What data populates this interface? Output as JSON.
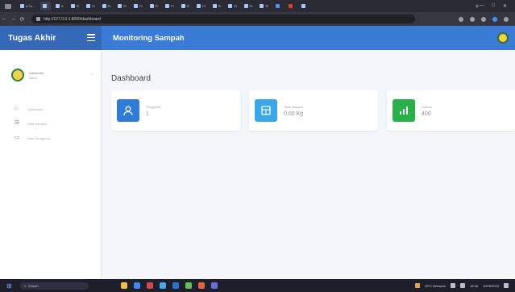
{
  "browser": {
    "tabs": [
      {
        "title": "A Tu…",
        "active": false
      },
      {
        "title": "",
        "active": true
      },
      {
        "title": "A",
        "active": false
      },
      {
        "title": "Pi",
        "active": false
      },
      {
        "title": "Pi",
        "active": false
      },
      {
        "title": "Pi",
        "active": false
      },
      {
        "title": "Pi",
        "active": false
      },
      {
        "title": "Pi",
        "active": false
      },
      {
        "title": "Pi",
        "active": false
      },
      {
        "title": "Pi",
        "active": false
      },
      {
        "title": "Pi",
        "active": false
      },
      {
        "title": "Pi",
        "active": false
      },
      {
        "title": "Pi",
        "active": false
      },
      {
        "title": "Pi",
        "active": false
      },
      {
        "title": "Pi",
        "active": false
      },
      {
        "title": "Pi",
        "active": false
      },
      {
        "title": "",
        "active": false
      },
      {
        "title": "",
        "active": false
      },
      {
        "title": "",
        "active": false
      }
    ],
    "url": "http://127.0.0.1:8000/dashboard"
  },
  "app": {
    "brand": "Tugas Akhir",
    "header_title": "Monitoring Sampah",
    "colors": {
      "primary": "#3a7bd5",
      "brand_bg": "#3569b8",
      "sidebar_bg": "#ffffff",
      "content_bg": "#f4f6f9"
    }
  },
  "sidebar": {
    "user_name": "Kasmodin",
    "user_role": "Admin",
    "menu": [
      {
        "label": "Dashboard",
        "icon": "home-icon"
      },
      {
        "label": "Data Sampah",
        "icon": "list-icon"
      },
      {
        "label": "Data Pengguna",
        "icon": "monitor-icon"
      }
    ]
  },
  "main": {
    "title": "Dashboard",
    "cards": [
      {
        "label": "Pengguna",
        "value": "1",
        "color": "#2f7bd8",
        "icon": "user-icon"
      },
      {
        "label": "Total sampah",
        "value": "0.00 Kg",
        "color": "#3aa7e9",
        "icon": "table-icon"
      },
      {
        "label": "Karbon",
        "value": "400",
        "color": "#29b04a",
        "icon": "chart-icon"
      }
    ]
  },
  "taskbar": {
    "search_placeholder": "Search",
    "tray_text": "26°C Berawan",
    "time": "10:06",
    "date": "10/06/2023"
  }
}
